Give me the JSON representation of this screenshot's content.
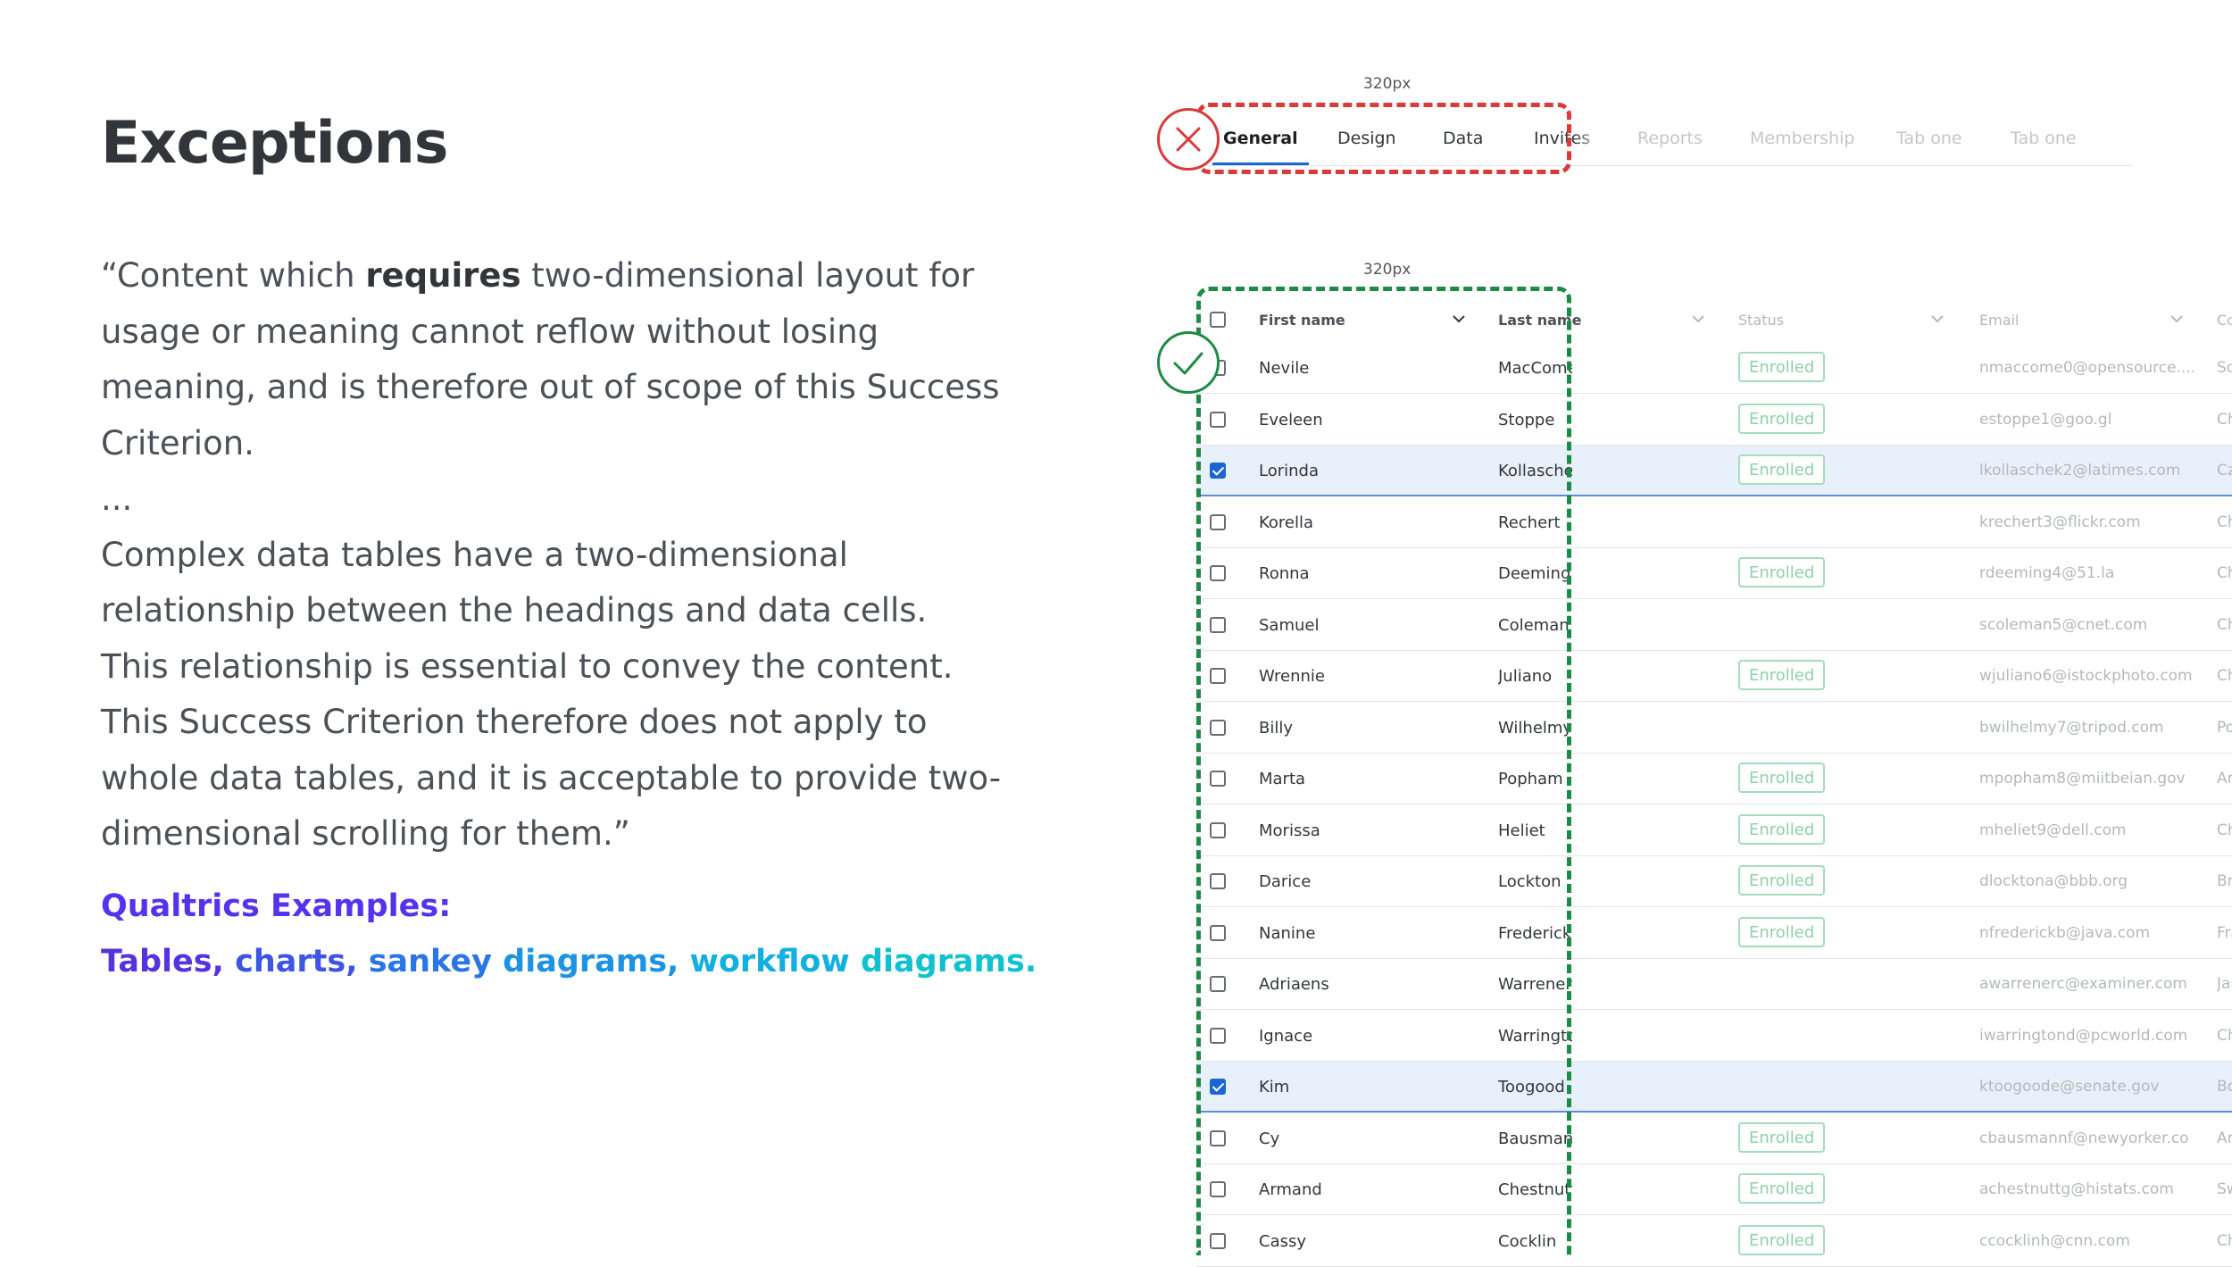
{
  "slide": {
    "title": "Exceptions",
    "quote": {
      "p1_before": "“Content which ",
      "p1_bold": "requires",
      "p1_after": " two-dimensional layout for usage or meaning cannot reflow without losing meaning, and is therefore out of scope of this Success Criterion.",
      "ellipsis": "...",
      "p2": "Complex data tables have a two-dimensional relationship between the headings and data cells. This relationship is essential to convey the content. This Success Criterion therefore does not apply to whole data tables, and it is acceptable to provide two-dimensional scrolling for them.”"
    },
    "examples_heading": "Qualtrics Examples:",
    "examples": [
      "Tables,",
      "charts,",
      "sankey",
      "diagrams,",
      "workflow",
      "diagrams."
    ]
  },
  "tabs_demo": {
    "width_label": "320px",
    "status_icon": "x-icon",
    "status_color": "#d93a3a",
    "tabs": [
      "General",
      "Design",
      "Data",
      "Invites",
      "Reports",
      "Membership",
      "Tab one",
      "Tab one"
    ],
    "active_tab": "General"
  },
  "table_demo": {
    "width_label": "320px",
    "status_icon": "checkmark-icon",
    "status_color": "#1d8a46",
    "columns": [
      "First name",
      "Last name",
      "Status",
      "Email",
      "Co"
    ],
    "rows": [
      {
        "checked": false,
        "first": "Nevile",
        "last": "MacCome",
        "status": "Enrolled",
        "email": "nmaccome0@opensource....",
        "country": "So"
      },
      {
        "checked": false,
        "first": "Eveleen",
        "last": "Stoppe",
        "status": "Enrolled",
        "email": "estoppe1@goo.gl",
        "country": "Ch"
      },
      {
        "checked": true,
        "first": "Lorinda",
        "last": "Kollaschek",
        "status": "Enrolled",
        "email": "lkollaschek2@latimes.com",
        "country": "Cz"
      },
      {
        "checked": false,
        "first": "Korella",
        "last": "Rechert",
        "status": "",
        "email": "krechert3@flickr.com",
        "country": "Ch"
      },
      {
        "checked": false,
        "first": "Ronna",
        "last": "Deeming",
        "status": "Enrolled",
        "email": "rdeeming4@51.la",
        "country": "Ch"
      },
      {
        "checked": false,
        "first": "Samuel",
        "last": "Coleman",
        "status": "",
        "email": "scoleman5@cnet.com",
        "country": "Ch"
      },
      {
        "checked": false,
        "first": "Wrennie",
        "last": "Juliano",
        "status": "Enrolled",
        "email": "wjuliano6@istockphoto.com",
        "country": "Ch"
      },
      {
        "checked": false,
        "first": "Billy",
        "last": "Wilhelmy",
        "status": "",
        "email": "bwilhelmy7@tripod.com",
        "country": "Po"
      },
      {
        "checked": false,
        "first": "Marta",
        "last": "Popham",
        "status": "Enrolled",
        "email": "mpopham8@miitbeian.gov",
        "country": "Arr"
      },
      {
        "checked": false,
        "first": "Morissa",
        "last": "Heliet",
        "status": "Enrolled",
        "email": "mheliet9@dell.com",
        "country": "Ch"
      },
      {
        "checked": false,
        "first": "Darice",
        "last": "Lockton",
        "status": "Enrolled",
        "email": "dlocktona@bbb.org",
        "country": "Bra"
      },
      {
        "checked": false,
        "first": "Nanine",
        "last": "Frederick",
        "status": "Enrolled",
        "email": "nfrederickb@java.com",
        "country": "Fra"
      },
      {
        "checked": false,
        "first": "Adriaens",
        "last": "Warrener",
        "status": "",
        "email": "awarrenerc@examiner.com",
        "country": "Jap"
      },
      {
        "checked": false,
        "first": "Ignace",
        "last": "Warrington",
        "status": "",
        "email": "iwarringtond@pcworld.com",
        "country": "Ch"
      },
      {
        "checked": true,
        "first": "Kim",
        "last": "Toogood",
        "status": "",
        "email": "ktoogoode@senate.gov",
        "country": "Bo"
      },
      {
        "checked": false,
        "first": "Cy",
        "last": "Bausmann",
        "status": "Enrolled",
        "email": "cbausmannf@newyorker.co",
        "country": "Arg"
      },
      {
        "checked": false,
        "first": "Armand",
        "last": "Chestnutt",
        "status": "Enrolled",
        "email": "achestnuttg@histats.com",
        "country": "Sw"
      },
      {
        "checked": false,
        "first": "Cassy",
        "last": "Cocklin",
        "status": "Enrolled",
        "email": "ccocklinh@cnn.com",
        "country": "Ch"
      }
    ]
  }
}
